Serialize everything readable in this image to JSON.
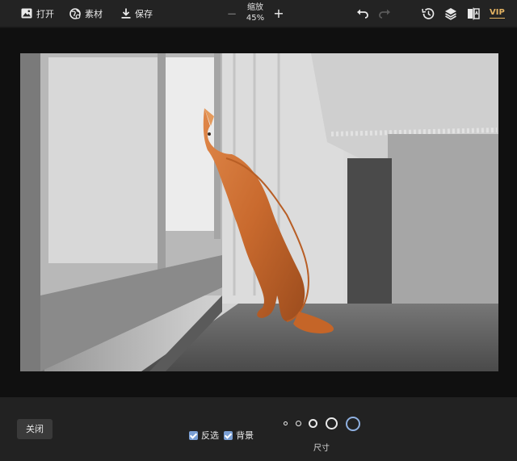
{
  "toolbar": {
    "open_label": "打开",
    "material_label": "素材",
    "save_label": "保存",
    "zoom_title": "缩放",
    "zoom_value": "45%",
    "zoom_minus": "−",
    "zoom_plus": "+",
    "vip_label": "VIP"
  },
  "icons": {
    "open": "image-icon",
    "material": "globe-icon",
    "save": "download-icon",
    "undo": "undo-icon",
    "redo": "redo-icon",
    "history": "history-icon",
    "layers": "layers-icon",
    "compare": "compare-icon"
  },
  "bottom": {
    "close_label": "关闭",
    "invert_label": "反选",
    "background_label": "背景",
    "size_label": "尺寸",
    "selected_size_index": 4
  },
  "colors": {
    "accent_vip": "#e3b262",
    "checkbox": "#7a9fd4",
    "selected_brush": "#8fb0e0"
  }
}
